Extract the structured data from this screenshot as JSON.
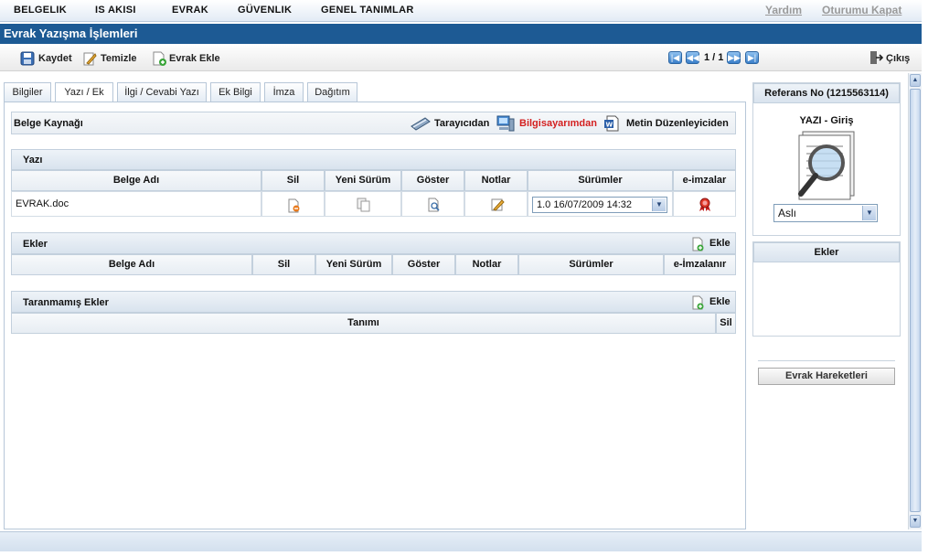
{
  "menu": {
    "items": [
      "BELGELIK",
      "IS AKISI",
      "EVRAK",
      "GÜVENLIK",
      "GENEL TANIMLAR"
    ],
    "help": "Yardım",
    "logout": "Oturumu Kapat"
  },
  "title": "Evrak Yazışma İşlemleri",
  "toolbar": {
    "save": "Kaydet",
    "clear": "Temizle",
    "add_doc": "Evrak Ekle",
    "page": "1 / 1",
    "exit": "Çıkış"
  },
  "tabs": [
    "Bilgiler",
    "Yazı / Ek",
    "İlgi / Cevabi Yazı",
    "Ek Bilgi",
    "İmza",
    "Dağıtım"
  ],
  "active_tab": "Yazı / Ek",
  "source": {
    "label": "Belge Kaynağı",
    "scanner": "Tarayıcıdan",
    "computer": "Bilgisayarımdan",
    "editor": "Metin Düzenleyiciden"
  },
  "yazi": {
    "title": "Yazı",
    "columns": [
      "Belge Adı",
      "Sil",
      "Yeni Sürüm",
      "Göster",
      "Notlar",
      "Sürümler",
      "e-imzalar"
    ],
    "rows": [
      {
        "name": "EVRAK.doc",
        "version": "1.0 16/07/2009 14:32"
      }
    ]
  },
  "ekler": {
    "title": "Ekler",
    "add": "Ekle",
    "columns": [
      "Belge Adı",
      "Sil",
      "Yeni Sürüm",
      "Göster",
      "Notlar",
      "Sürümler",
      "e-İmzalanır"
    ]
  },
  "taranmamis": {
    "title": "Taranmamış Ekler",
    "add": "Ekle",
    "columns": [
      "Tanımı",
      "Sil"
    ]
  },
  "right_panel": {
    "ref": "Referans No (1215563114)",
    "doc_type": "YAZI - Giriş",
    "copy_select": "Aslı",
    "attachments": "Ekler",
    "history_button": "Evrak Hareketleri"
  },
  "colors": {
    "title_bg": "#1d5a94",
    "accent_red": "#d32020"
  }
}
